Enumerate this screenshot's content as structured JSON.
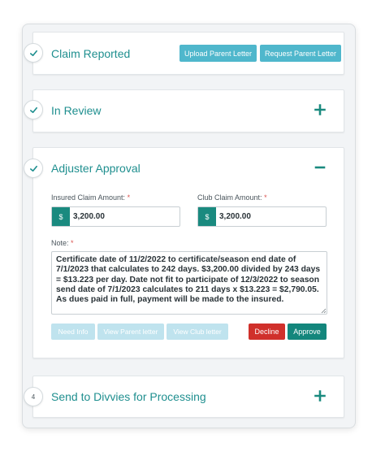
{
  "steps": [
    {
      "badge": "",
      "title": "Claim Reported",
      "buttons": {
        "upload_parent_letter": "Upload Parent Letter",
        "request_parent_letter": "Request Parent Letter"
      }
    },
    {
      "badge": "",
      "title": "In Review",
      "toggle": "plus-icon"
    },
    {
      "badge": "",
      "title": "Adjuster Approval",
      "toggle": "minus-icon"
    },
    {
      "badge": "4",
      "title": "Send to Divvies for Processing",
      "toggle": "plus-icon"
    }
  ],
  "approval": {
    "insured_label": "Insured Claim Amount:",
    "club_label": "Club Claim Amount:",
    "required_mark": "*",
    "currency_symbol": "$",
    "insured_amount": "3,200.00",
    "club_amount": "3,200.00",
    "note_label": "Note:",
    "note_text": "Certificate date of 11/2/2022 to certificate/season end date of 7/1/2023 that calculates to 242 days. $3,200.00 divided by 243 days = $13.223 per day. Date not fit to participate of 12/3/2022 to season send date of 7/1/2023 calculates to 211 days x $13.223 = $2,790.05. As dues paid in full, payment will be made to the insured.",
    "buttons": {
      "need_info": "Need Info",
      "view_parent_letter": "View Parent letter",
      "view_club_letter": "View Club letter",
      "decline": "Decline",
      "approve": "Approve"
    }
  },
  "colors": {
    "accent": "#1f8f8f",
    "light_button": "#4fb7cc",
    "disabled_button": "#bfe3ee",
    "decline": "#d0302b",
    "approve": "#13867c"
  }
}
